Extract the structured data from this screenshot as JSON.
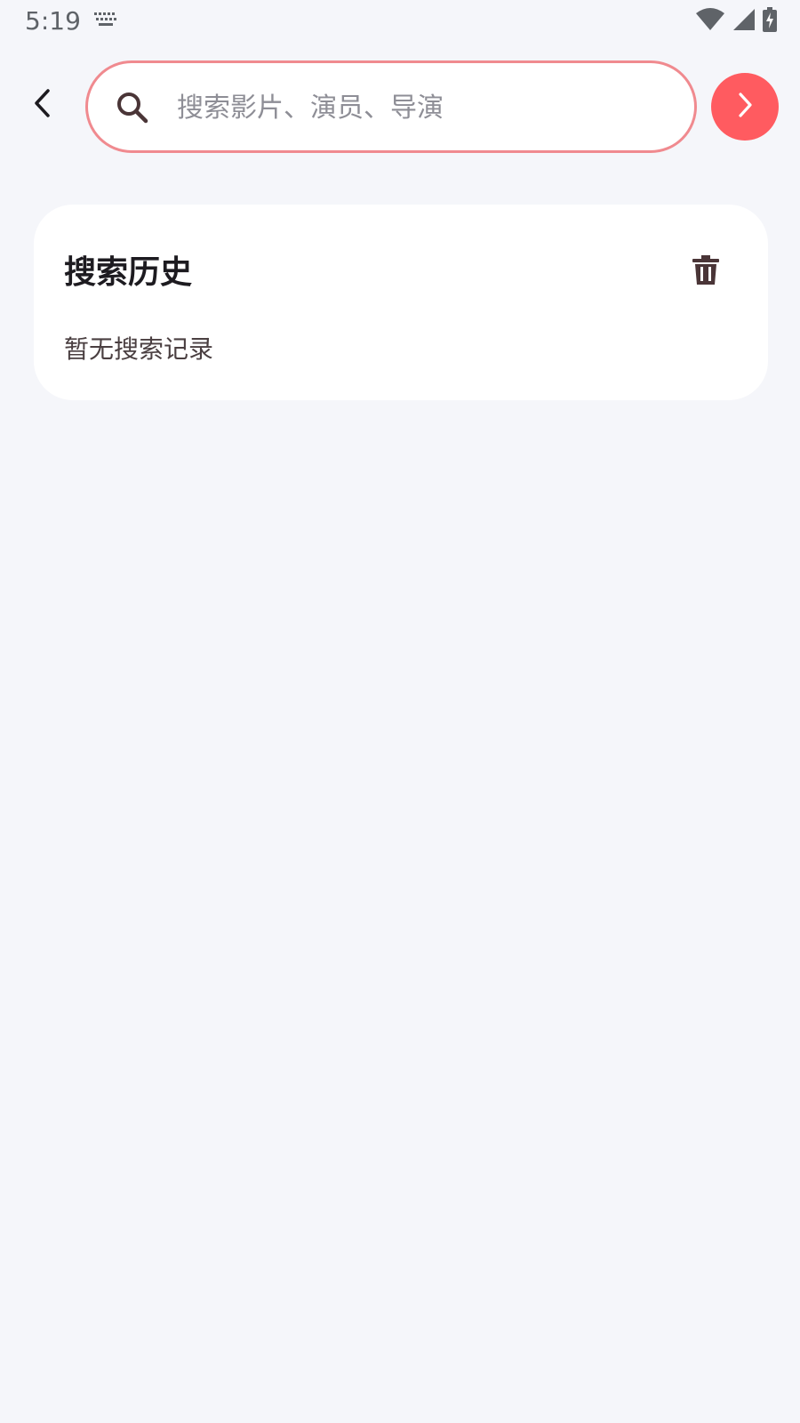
{
  "status_bar": {
    "time": "5:19"
  },
  "search": {
    "placeholder": "搜索影片、演员、导演",
    "value": ""
  },
  "history": {
    "title": "搜索历史",
    "empty_text": "暂无搜索记录"
  },
  "colors": {
    "background": "#F5F6FA",
    "accent": "#FF5B60",
    "search_border": "#F08A8F",
    "card": "#FFFFFF",
    "title_text": "#1D1B20",
    "muted_text": "#4A3F41",
    "icon_dark": "#4A3537"
  },
  "icons": {
    "status_keyboard": "keyboard-icon",
    "status_wifi": "wifi-icon",
    "status_signal": "signal-icon",
    "status_battery": "battery-charging-icon",
    "back": "chevron-left-icon",
    "search": "search-icon",
    "go": "chevron-right-icon",
    "clear_history": "trash-icon"
  }
}
